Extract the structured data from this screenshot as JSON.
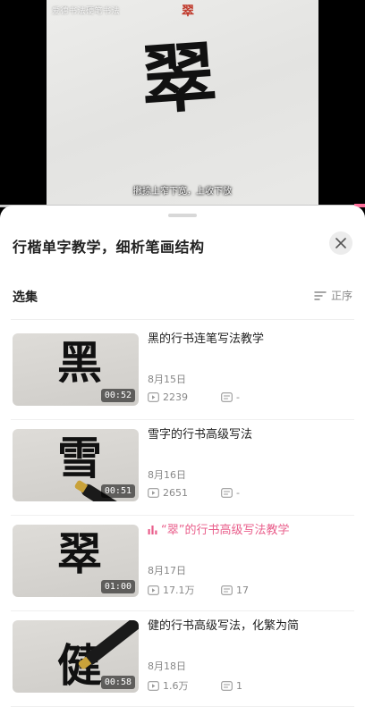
{
  "video": {
    "watermark": "爱德书法硬笔书法",
    "top_char": "翠",
    "big_char": "翠",
    "subtitle": "撇捺上窄下宽，上收下放"
  },
  "sheet": {
    "title": "行楷单字教学，细析笔画结构",
    "section_label": "选集",
    "sort_label": "正序"
  },
  "episodes": [
    {
      "title": "黑的行书连笔写法教学",
      "char": "黑",
      "duration": "00:52",
      "date": "8月15日",
      "views": "2239",
      "comments": "-",
      "active": false
    },
    {
      "title": "雪字的行书高级写法",
      "char": "雪",
      "duration": "00:51",
      "date": "8月16日",
      "views": "2651",
      "comments": "-",
      "active": false
    },
    {
      "title": "“翠”的行书高级写法教学",
      "char": "翠",
      "duration": "01:00",
      "date": "8月17日",
      "views": "17.1万",
      "comments": "17",
      "active": true
    },
    {
      "title": "健的行书高级写法，化繁为简",
      "char": "健",
      "duration": "00:58",
      "date": "8月18日",
      "views": "1.6万",
      "comments": "1",
      "active": false
    }
  ],
  "colors": {
    "accent": "#e95e8b",
    "text": "#222222",
    "muted": "#888888"
  }
}
